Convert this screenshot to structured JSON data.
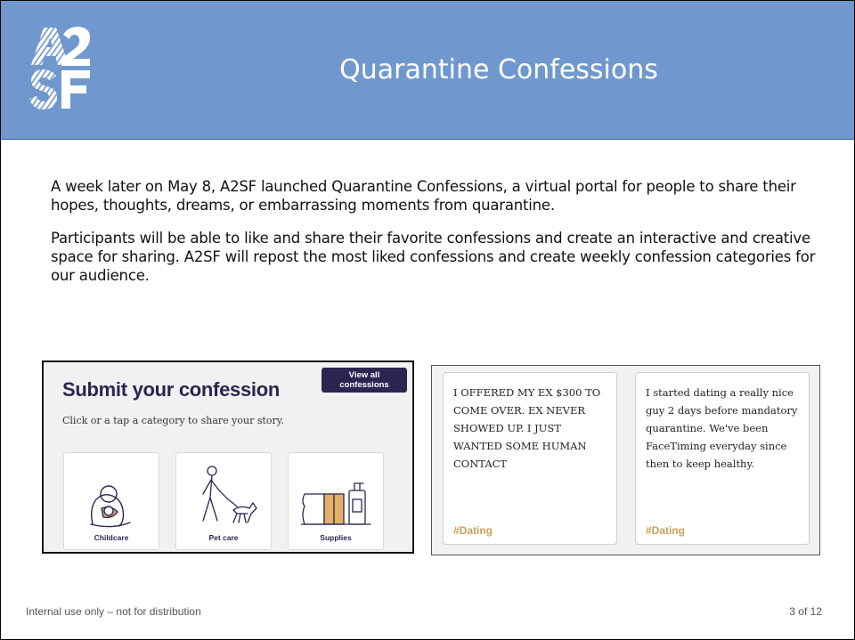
{
  "header": {
    "logo_text": "A2SF",
    "title": "Quarantine Confessions",
    "background_color": "#7098cf"
  },
  "body": {
    "paragraphs": [
      "A week later on May 8, A2SF launched Quarantine Confessions, a virtual portal for people to share their hopes, thoughts, dreams, or embarrassing moments from quarantine.",
      "Participants will be able to like and share their favorite confessions and create an interactive and creative space for sharing. A2SF will repost the most liked confessions and create weekly confession categories for our audience."
    ]
  },
  "submit_panel": {
    "title": "Submit your confession",
    "view_all_label": "View all confessions",
    "subtitle": "Click or a tap a category to share your story.",
    "categories": [
      {
        "label": "Childcare",
        "icon": "childcare-icon"
      },
      {
        "label": "Pet care",
        "icon": "dog-walking-icon"
      },
      {
        "label": "Supplies",
        "icon": "supplies-icon"
      }
    ],
    "accent_color": "#2b2552"
  },
  "confessions": [
    {
      "text": "I OFFERED MY EX $300 TO COME OVER. EX NEVER SHOWED UP. I JUST WANTED SOME HUMAN CONTACT",
      "tag": "#Dating"
    },
    {
      "text": "I started dating a really nice guy 2 days before mandatory quarantine. We've been FaceTiming everyday since then to keep healthy.",
      "tag": "#Dating"
    }
  ],
  "tag_color": "#c9a15b",
  "footer": {
    "note": "Internal use only – not for distribution",
    "page": "3 of 12"
  }
}
